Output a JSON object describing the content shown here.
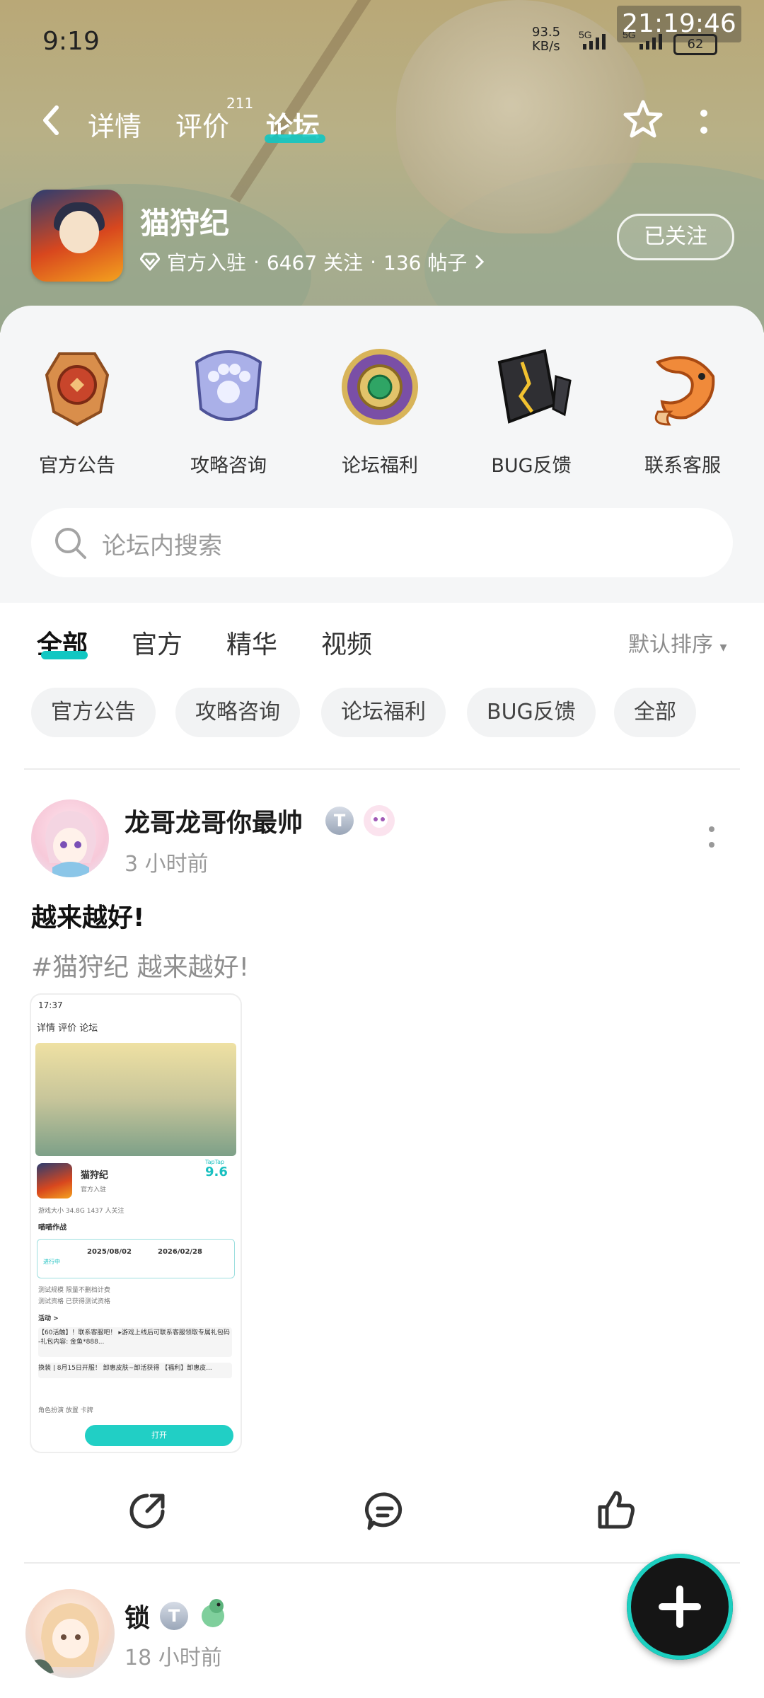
{
  "status_bar": {
    "time": "9:19",
    "net_speed_value": "93.5",
    "net_speed_unit": "KB/s",
    "network_1": "5G",
    "network_2": "5G",
    "battery": "62",
    "overlay_clock": "21:19:46"
  },
  "nav": {
    "tabs": [
      {
        "label": "详情"
      },
      {
        "label": "评价",
        "badge": "211"
      },
      {
        "label": "论坛",
        "active": true
      }
    ]
  },
  "app": {
    "name": "猫狩纪",
    "official": "官方入驻",
    "followers": "6467 关注",
    "posts": "136 帖子",
    "follow_state": "已关注",
    "separator": "·"
  },
  "forum_categories": [
    {
      "label": "官方公告",
      "icon": "announcement-icon"
    },
    {
      "label": "攻略咨询",
      "icon": "paw-plaque-icon"
    },
    {
      "label": "论坛福利",
      "icon": "gem-badge-icon"
    },
    {
      "label": "BUG反馈",
      "icon": "broken-stone-icon"
    },
    {
      "label": "联系客服",
      "icon": "koi-fish-icon"
    }
  ],
  "search": {
    "placeholder": "论坛内搜索"
  },
  "filter_tabs": [
    {
      "label": "全部",
      "active": true
    },
    {
      "label": "官方"
    },
    {
      "label": "精华"
    },
    {
      "label": "视频"
    }
  ],
  "sort": {
    "label": "默认排序"
  },
  "chips": [
    "官方公告",
    "攻略咨询",
    "论坛福利",
    "BUG反馈",
    "全部"
  ],
  "posts": [
    {
      "user": "龙哥龙哥你最帅",
      "level": "T",
      "time": "3 小时前",
      "title": "越来越好!",
      "tag_text": "#猫狩纪 越来越好!",
      "screenshot": {
        "status_time": "17:37",
        "nav": "详情  评价  论坛",
        "app_name": "猫狩纪",
        "official": "官方入驻",
        "score": "9.6",
        "score_brand": "TapTap",
        "stats": "游戏大小 34.8G   1437 人关注",
        "test_title": "喵喵作战",
        "date_start": "2025/08/02",
        "date_end": "2026/02/28",
        "status": "进行中",
        "test_scale": "测试规模   限量不删档计费",
        "test_qual": "测试资格   已获得测试资格",
        "activity": "活动 >",
        "act_1": "【60活触】！联系客服吧！ ▸游戏上线后可联系客服领取专属礼包码 -礼包内容: 金鱼*888...",
        "act_2": "换装 | 8月15日开服！ 卸惠皮肤~卸活获得 【福利】卸惠皮...",
        "tags": "角色扮演  放置  卡牌",
        "open": "打开"
      }
    },
    {
      "user": "锁",
      "level": "T",
      "time": "18 小时前"
    }
  ],
  "fab": {
    "icon": "plus-icon"
  }
}
